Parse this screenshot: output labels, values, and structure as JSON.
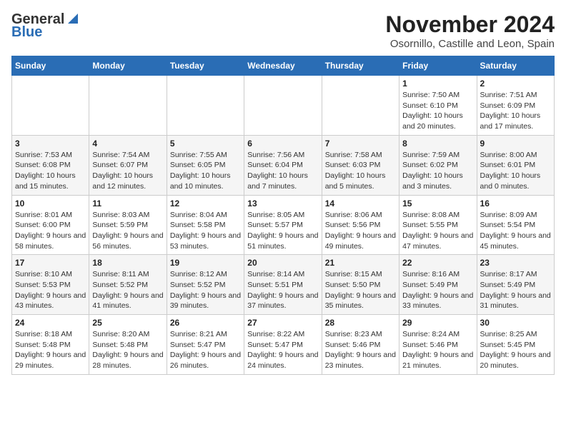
{
  "header": {
    "logo_general": "General",
    "logo_blue": "Blue",
    "title": "November 2024",
    "subtitle": "Osornillo, Castille and Leon, Spain"
  },
  "weekdays": [
    "Sunday",
    "Monday",
    "Tuesday",
    "Wednesday",
    "Thursday",
    "Friday",
    "Saturday"
  ],
  "weeks": [
    [
      {
        "day": "",
        "info": ""
      },
      {
        "day": "",
        "info": ""
      },
      {
        "day": "",
        "info": ""
      },
      {
        "day": "",
        "info": ""
      },
      {
        "day": "",
        "info": ""
      },
      {
        "day": "1",
        "info": "Sunrise: 7:50 AM\nSunset: 6:10 PM\nDaylight: 10 hours and 20 minutes."
      },
      {
        "day": "2",
        "info": "Sunrise: 7:51 AM\nSunset: 6:09 PM\nDaylight: 10 hours and 17 minutes."
      }
    ],
    [
      {
        "day": "3",
        "info": "Sunrise: 7:53 AM\nSunset: 6:08 PM\nDaylight: 10 hours and 15 minutes."
      },
      {
        "day": "4",
        "info": "Sunrise: 7:54 AM\nSunset: 6:07 PM\nDaylight: 10 hours and 12 minutes."
      },
      {
        "day": "5",
        "info": "Sunrise: 7:55 AM\nSunset: 6:05 PM\nDaylight: 10 hours and 10 minutes."
      },
      {
        "day": "6",
        "info": "Sunrise: 7:56 AM\nSunset: 6:04 PM\nDaylight: 10 hours and 7 minutes."
      },
      {
        "day": "7",
        "info": "Sunrise: 7:58 AM\nSunset: 6:03 PM\nDaylight: 10 hours and 5 minutes."
      },
      {
        "day": "8",
        "info": "Sunrise: 7:59 AM\nSunset: 6:02 PM\nDaylight: 10 hours and 3 minutes."
      },
      {
        "day": "9",
        "info": "Sunrise: 8:00 AM\nSunset: 6:01 PM\nDaylight: 10 hours and 0 minutes."
      }
    ],
    [
      {
        "day": "10",
        "info": "Sunrise: 8:01 AM\nSunset: 6:00 PM\nDaylight: 9 hours and 58 minutes."
      },
      {
        "day": "11",
        "info": "Sunrise: 8:03 AM\nSunset: 5:59 PM\nDaylight: 9 hours and 56 minutes."
      },
      {
        "day": "12",
        "info": "Sunrise: 8:04 AM\nSunset: 5:58 PM\nDaylight: 9 hours and 53 minutes."
      },
      {
        "day": "13",
        "info": "Sunrise: 8:05 AM\nSunset: 5:57 PM\nDaylight: 9 hours and 51 minutes."
      },
      {
        "day": "14",
        "info": "Sunrise: 8:06 AM\nSunset: 5:56 PM\nDaylight: 9 hours and 49 minutes."
      },
      {
        "day": "15",
        "info": "Sunrise: 8:08 AM\nSunset: 5:55 PM\nDaylight: 9 hours and 47 minutes."
      },
      {
        "day": "16",
        "info": "Sunrise: 8:09 AM\nSunset: 5:54 PM\nDaylight: 9 hours and 45 minutes."
      }
    ],
    [
      {
        "day": "17",
        "info": "Sunrise: 8:10 AM\nSunset: 5:53 PM\nDaylight: 9 hours and 43 minutes."
      },
      {
        "day": "18",
        "info": "Sunrise: 8:11 AM\nSunset: 5:52 PM\nDaylight: 9 hours and 41 minutes."
      },
      {
        "day": "19",
        "info": "Sunrise: 8:12 AM\nSunset: 5:52 PM\nDaylight: 9 hours and 39 minutes."
      },
      {
        "day": "20",
        "info": "Sunrise: 8:14 AM\nSunset: 5:51 PM\nDaylight: 9 hours and 37 minutes."
      },
      {
        "day": "21",
        "info": "Sunrise: 8:15 AM\nSunset: 5:50 PM\nDaylight: 9 hours and 35 minutes."
      },
      {
        "day": "22",
        "info": "Sunrise: 8:16 AM\nSunset: 5:49 PM\nDaylight: 9 hours and 33 minutes."
      },
      {
        "day": "23",
        "info": "Sunrise: 8:17 AM\nSunset: 5:49 PM\nDaylight: 9 hours and 31 minutes."
      }
    ],
    [
      {
        "day": "24",
        "info": "Sunrise: 8:18 AM\nSunset: 5:48 PM\nDaylight: 9 hours and 29 minutes."
      },
      {
        "day": "25",
        "info": "Sunrise: 8:20 AM\nSunset: 5:48 PM\nDaylight: 9 hours and 28 minutes."
      },
      {
        "day": "26",
        "info": "Sunrise: 8:21 AM\nSunset: 5:47 PM\nDaylight: 9 hours and 26 minutes."
      },
      {
        "day": "27",
        "info": "Sunrise: 8:22 AM\nSunset: 5:47 PM\nDaylight: 9 hours and 24 minutes."
      },
      {
        "day": "28",
        "info": "Sunrise: 8:23 AM\nSunset: 5:46 PM\nDaylight: 9 hours and 23 minutes."
      },
      {
        "day": "29",
        "info": "Sunrise: 8:24 AM\nSunset: 5:46 PM\nDaylight: 9 hours and 21 minutes."
      },
      {
        "day": "30",
        "info": "Sunrise: 8:25 AM\nSunset: 5:45 PM\nDaylight: 9 hours and 20 minutes."
      }
    ]
  ]
}
